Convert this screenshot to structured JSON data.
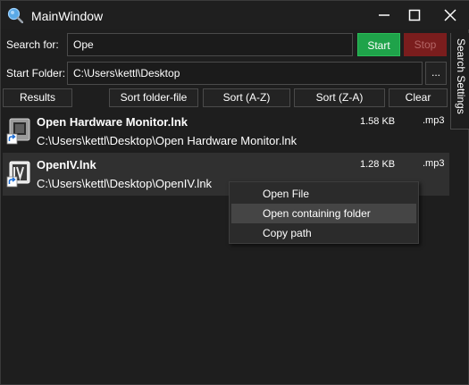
{
  "window": {
    "title": "MainWindow"
  },
  "search": {
    "label": "Search for:",
    "value": "Ope",
    "start_label": "Start",
    "stop_label": "Stop"
  },
  "folder": {
    "label": "Start Folder:",
    "value": "C:\\Users\\kettl\\Desktop",
    "browse_label": "..."
  },
  "side_tab": {
    "label": "Search Settings"
  },
  "toolbar": {
    "results_label": "Results",
    "sort_folder_file_label": "Sort folder-file",
    "sort_az_label": "Sort (A-Z)",
    "sort_za_label": "Sort (Z-A)",
    "clear_label": "Clear"
  },
  "results": [
    {
      "name": "Open Hardware Monitor.lnk",
      "path": "C:\\Users\\kettl\\Desktop\\Open Hardware Monitor.lnk",
      "size": "1.58 KB",
      "ext": ".mp3",
      "icon": "shortcut-icon"
    },
    {
      "name": "OpenIV.lnk",
      "path": "C:\\Users\\kettl\\Desktop\\OpenIV.lnk",
      "size": "1.28 KB",
      "ext": ".mp3",
      "icon": "openiv-shortcut-icon"
    }
  ],
  "context_menu": {
    "items": [
      "Open File",
      "Open containing folder",
      "Copy path"
    ],
    "highlighted": "Open containing folder"
  },
  "colors": {
    "background": "#1e1e1e",
    "start_button": "#1fa34a",
    "stop_button": "#7a1d1d",
    "selected_row": "#303030",
    "menu_highlight": "#454545"
  }
}
